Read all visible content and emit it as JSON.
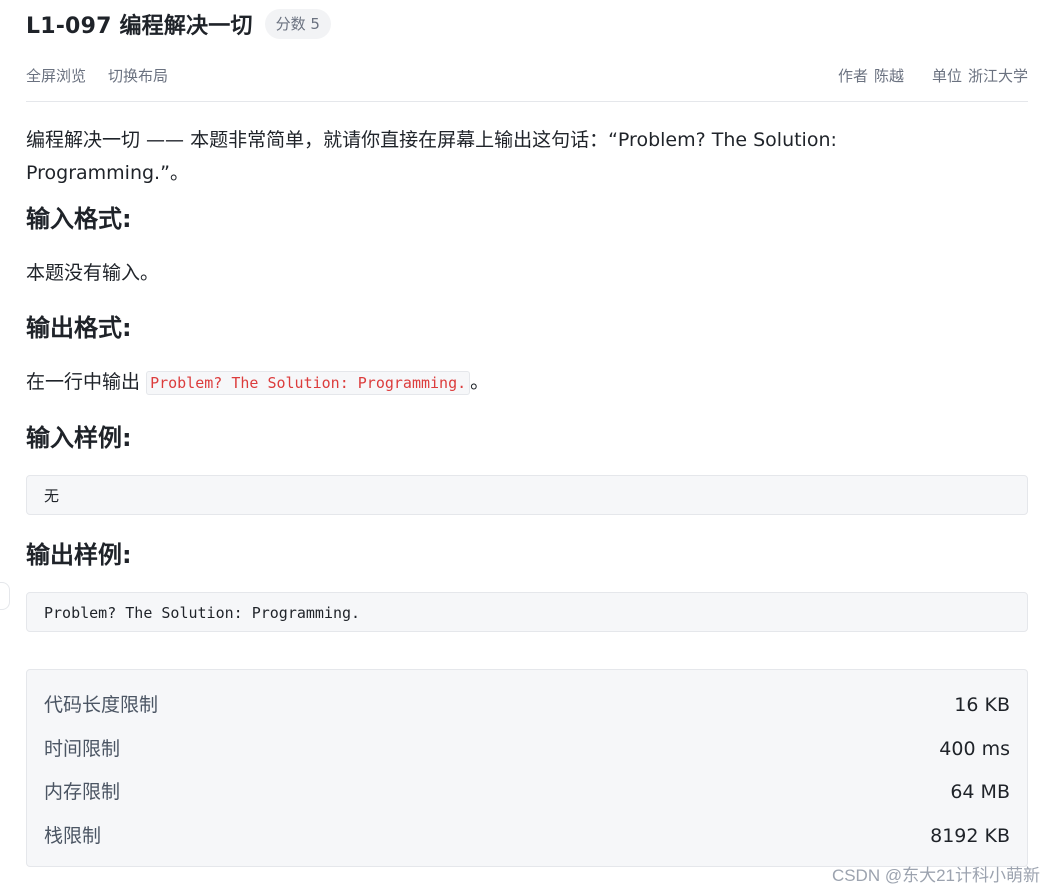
{
  "header": {
    "title": "L1-097 编程解决一切",
    "score_badge": "分数 5"
  },
  "toolbar": {
    "fullscreen_label": "全屏浏览",
    "switch_layout_label": "切换布局",
    "author_label": "作者",
    "author_value": "陈越",
    "org_label": "单位",
    "org_value": "浙江大学"
  },
  "problem": {
    "description": "编程解决一切 —— 本题非常简单，就请你直接在屏幕上输出这句话：“Problem? The Solution: Programming.”。",
    "input_format_heading": "输入格式:",
    "input_format_text": "本题没有输入。",
    "output_format_heading": "输出格式:",
    "output_format_prefix": "在一行中输出",
    "output_format_code": "Problem? The Solution: Programming.",
    "output_format_suffix": "。",
    "sample_input_heading": "输入样例:",
    "sample_input": "无",
    "sample_output_heading": "输出样例:",
    "sample_output": "Problem? The Solution: Programming."
  },
  "limits": [
    {
      "label": "代码长度限制",
      "value": "16 KB"
    },
    {
      "label": "时间限制",
      "value": "400 ms"
    },
    {
      "label": "内存限制",
      "value": "64 MB"
    },
    {
      "label": "栈限制",
      "value": "8192 KB"
    }
  ],
  "watermark": "CSDN @东大21计科小萌新"
}
